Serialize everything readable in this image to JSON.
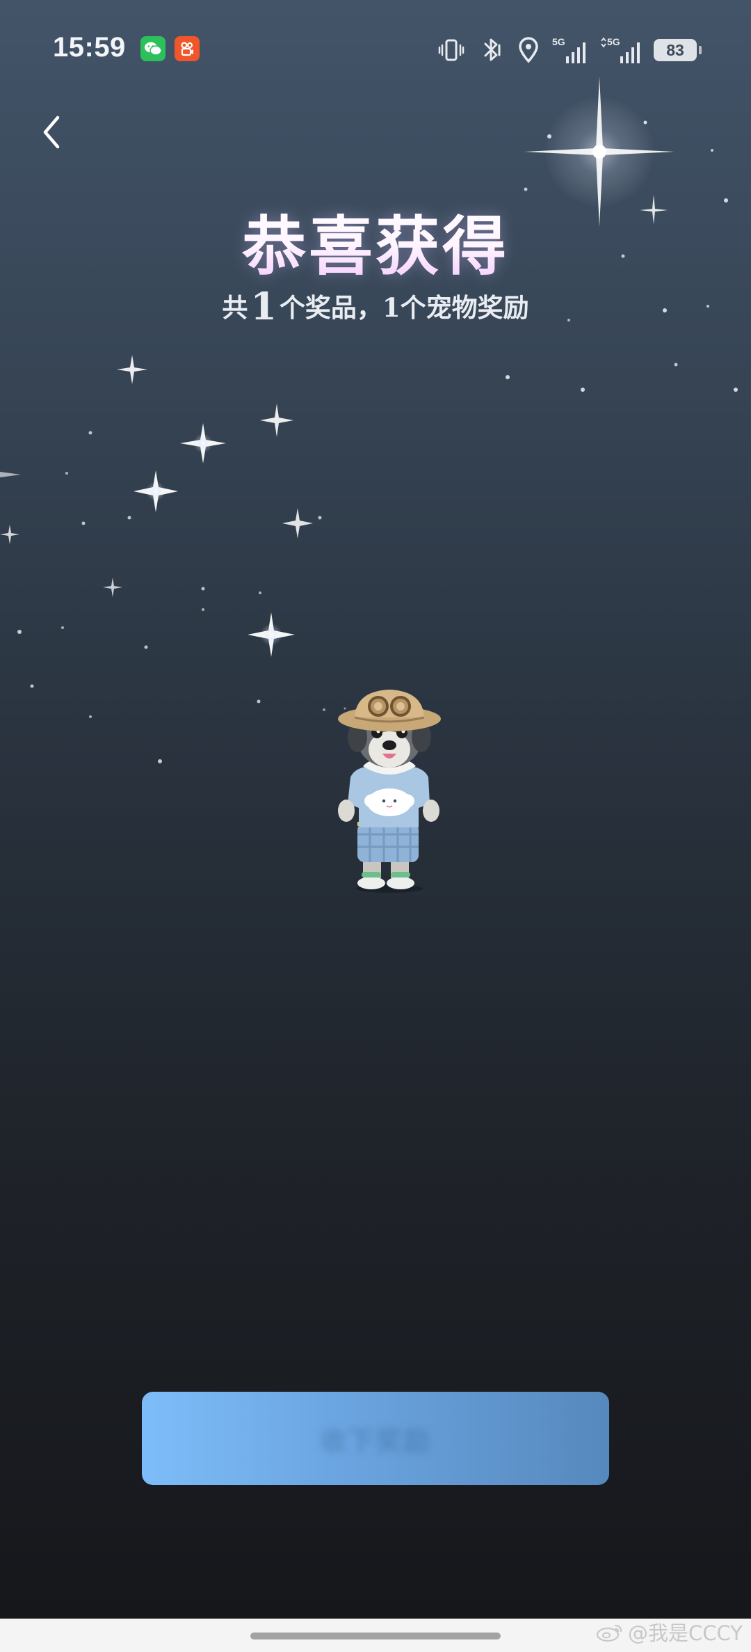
{
  "status_bar": {
    "time": "15:59",
    "apps": [
      "wechat-icon",
      "kuaishou-icon"
    ],
    "indicators": [
      "vibrate-icon",
      "bluetooth-icon",
      "location-icon",
      "5g-signal-icon",
      "5g-signal-icon"
    ],
    "network_1": "5G",
    "network_2": "5G",
    "battery": "83"
  },
  "header": {
    "back_icon": "chevron-left-icon"
  },
  "reward": {
    "title": "恭喜获得",
    "subtitle_prefix": "共",
    "item_count": "1",
    "subtitle_suffix": "个奖品，1个宠物奖励",
    "pet_image": "schnauzer-pet-illustration"
  },
  "confirm_button": {
    "label": "收下奖励"
  },
  "watermark": {
    "text": "@我是CCCY",
    "icon": "weibo-icon"
  },
  "colors": {
    "button_start": "#7dbdf9",
    "button_end": "#5689bd",
    "background_top": "#435469",
    "background_bottom": "#15161a"
  }
}
